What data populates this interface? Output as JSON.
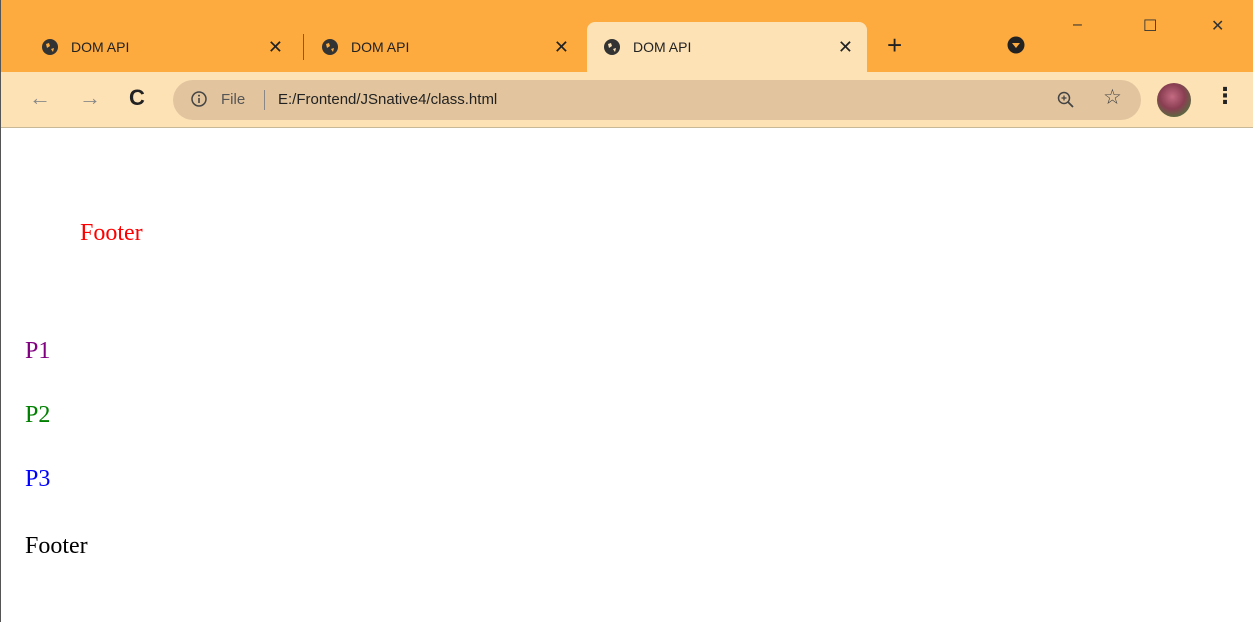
{
  "browser": {
    "tabs": [
      {
        "title": "DOM API",
        "close": "✕"
      },
      {
        "title": "DOM API",
        "close": "✕"
      },
      {
        "title": "DOM API",
        "close": "✕",
        "active": true
      }
    ],
    "new_tab": "+",
    "window_controls": {
      "minimize": "–",
      "maximize": "☐",
      "close": "✕"
    },
    "nav": {
      "back": "←",
      "forward": "→",
      "reload": "C"
    },
    "address": {
      "chip": "File",
      "url": "E:/Frontend/JSnative4/class.html"
    },
    "toolbar": {
      "star": "☆",
      "menu": "⋮"
    },
    "accent_color": "#fdab3f",
    "toolbar_color": "#fde2b6"
  },
  "page": {
    "items": [
      {
        "text": "Footer",
        "color": "#ff0000"
      },
      {
        "text": "P1",
        "color": "#800080"
      },
      {
        "text": "P2",
        "color": "#008000"
      },
      {
        "text": "P3",
        "color": "#0000ff"
      },
      {
        "text": "Footer",
        "color": "#000000"
      }
    ]
  }
}
